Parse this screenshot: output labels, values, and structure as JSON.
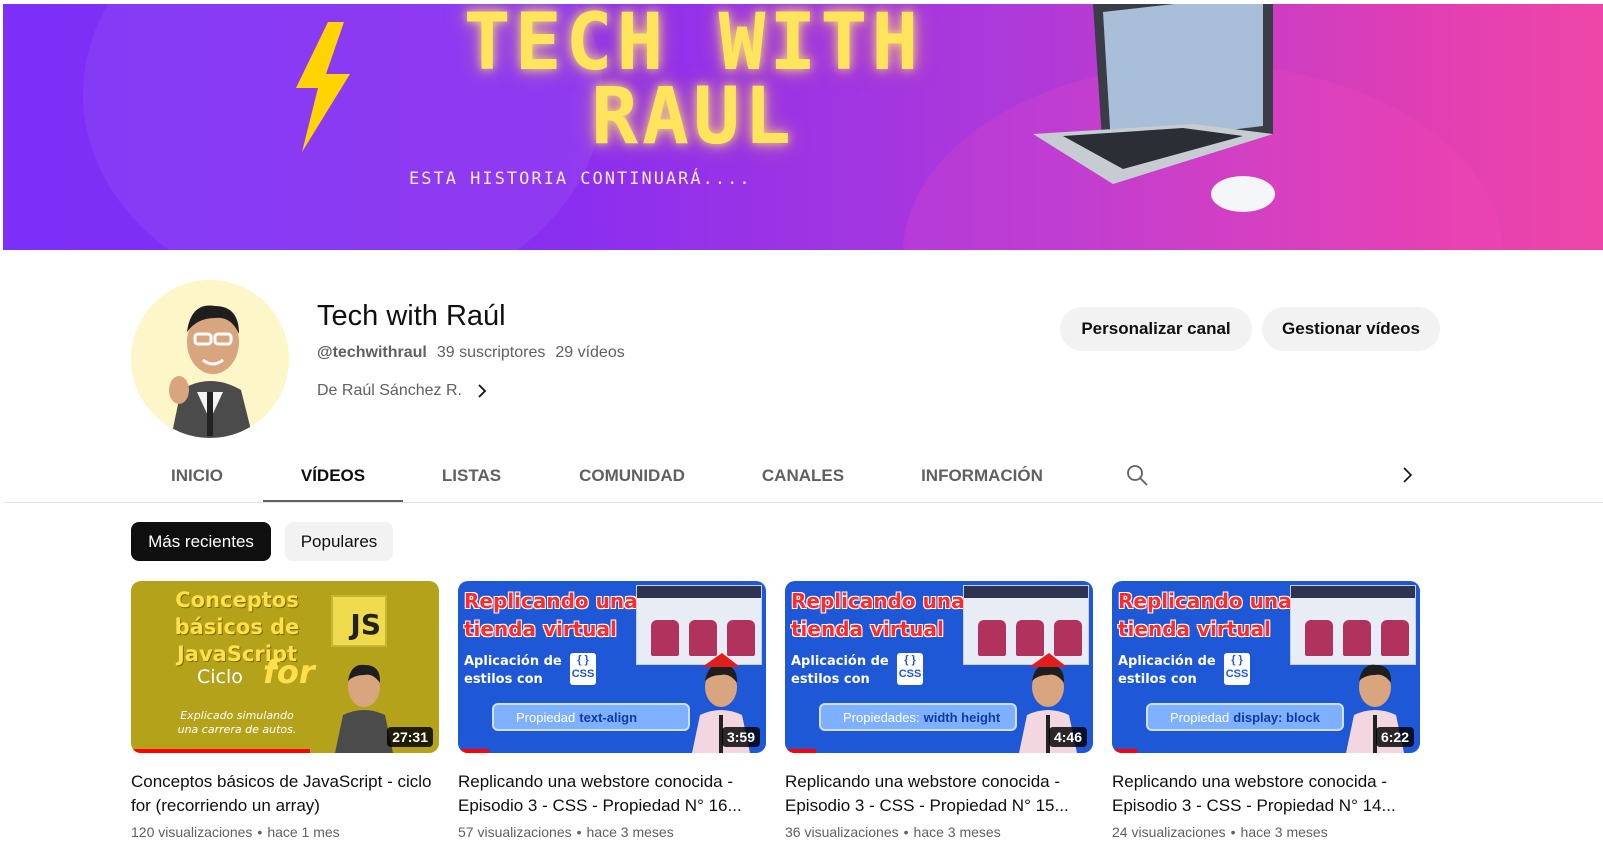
{
  "banner": {
    "title_line1": "TECH WITH",
    "title_line2": "RAUL",
    "subtitle": "ESTA HISTORIA CONTINUARÁ...."
  },
  "channel": {
    "name": "Tech with Raúl",
    "handle": "@techwithraul",
    "subscribers": "39 suscriptores",
    "videos_count": "29 vídeos",
    "owner": "De Raúl Sánchez R."
  },
  "actions": {
    "customize": "Personalizar canal",
    "manage": "Gestionar vídeos"
  },
  "tabs": [
    {
      "label": "INICIO"
    },
    {
      "label": "VÍDEOS"
    },
    {
      "label": "LISTAS"
    },
    {
      "label": "COMUNIDAD"
    },
    {
      "label": "CANALES"
    },
    {
      "label": "INFORMACIÓN"
    }
  ],
  "active_tab": "VÍDEOS",
  "chips": [
    {
      "label": "Más recientes"
    },
    {
      "label": "Populares"
    }
  ],
  "videos": [
    {
      "title": "Conceptos básicos de JavaScript - ciclo for (recorriendo un array)",
      "duration": "27:31",
      "views": "120 visualizaciones",
      "age": "hace 1 mes",
      "watched": 0.58,
      "thumb": {
        "head": "Conceptos básicos de JavaScript",
        "badge": "JS",
        "ciclo": "Ciclo",
        "keyword": "for",
        "note": "Explicado simulando una carrera de autos."
      }
    },
    {
      "title": "Replicando una webstore conocida - Episodio 3 - CSS - Propiedad N° 16...",
      "duration": "3:59",
      "views": "57 visualizaciones",
      "age": "hace 3 meses",
      "watched": 0.1,
      "thumb": {
        "head": "Replicando una tienda virtual",
        "sub": "Aplicación de estilos con",
        "prop_label": "Propiedad",
        "prop_value": "text-align"
      }
    },
    {
      "title": "Replicando una webstore conocida - Episodio 3 - CSS - Propiedad N° 15...",
      "duration": "4:46",
      "views": "36 visualizaciones",
      "age": "hace 3 meses",
      "watched": 0.1,
      "thumb": {
        "head": "Replicando una tienda virtual",
        "sub": "Aplicación de estilos con",
        "prop_label": "Propiedades:",
        "prop_value": "width height"
      }
    },
    {
      "title": "Replicando una webstore conocida - Episodio 3 - CSS - Propiedad N° 14...",
      "duration": "6:22",
      "views": "24 visualizaciones",
      "age": "hace 3 meses",
      "watched": 0.08,
      "thumb": {
        "head": "Replicando una tienda virtual",
        "sub": "Aplicación de estilos con",
        "prop_label": "Propiedad",
        "prop_value": "display: block"
      }
    }
  ],
  "meta_separator": "•",
  "colors": {
    "progress": "#ff0000",
    "chip_active": "#0f0f0f",
    "banner_start": "#7b2ff7",
    "banner_end": "#ee46a8"
  }
}
